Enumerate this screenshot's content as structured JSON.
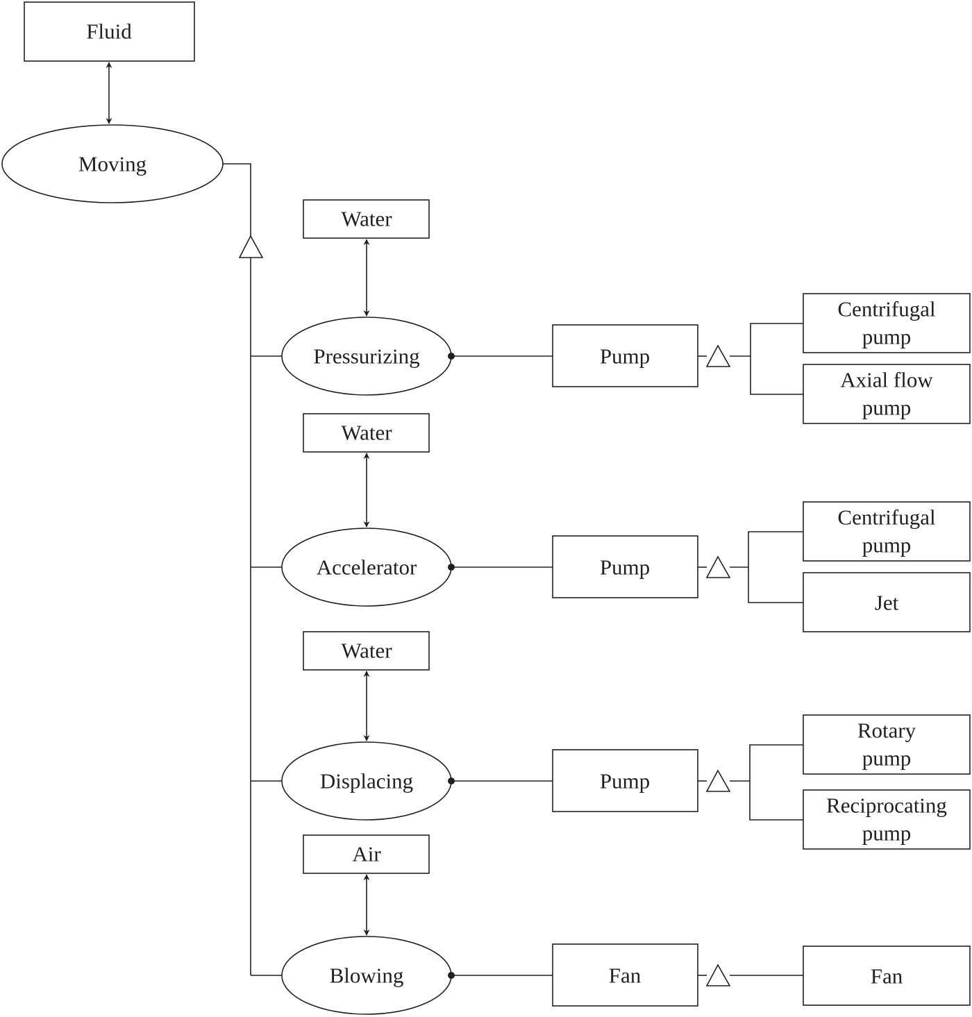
{
  "root": {
    "box": "Fluid",
    "function": "Moving"
  },
  "branches": [
    {
      "input": "Water",
      "function": "Pressurizing",
      "device": "Pump",
      "types": [
        [
          "Centrifugal",
          "pump"
        ],
        [
          "Axial flow",
          "pump"
        ]
      ]
    },
    {
      "input": "Water",
      "function": "Accelerator",
      "device": "Pump",
      "types": [
        [
          "Centrifugal",
          "pump"
        ],
        [
          "Jet"
        ]
      ]
    },
    {
      "input": "Water",
      "function": "Displacing",
      "device": "Pump",
      "types": [
        [
          "Rotary",
          "pump"
        ],
        [
          "Reciprocating",
          "pump"
        ]
      ]
    },
    {
      "input": "Air",
      "function": "Blowing",
      "device": "Fan",
      "types": [
        [
          "Fan"
        ]
      ]
    }
  ]
}
